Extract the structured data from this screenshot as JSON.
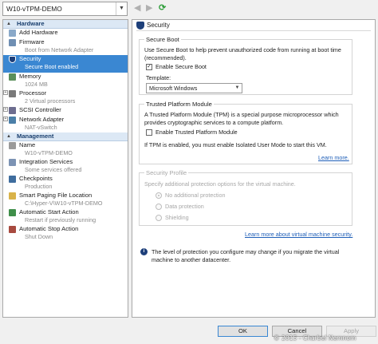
{
  "toolbar": {
    "vm_name": "W10-vTPM-DEMO",
    "back_glyph": "◀",
    "forward_glyph": "▶",
    "refresh_glyph": "⟳"
  },
  "sidebar": {
    "hardware": {
      "title": "Hardware",
      "items": [
        {
          "label": "Add Hardware",
          "sub": "",
          "icon": "add-hardware-icon"
        },
        {
          "label": "Firmware",
          "sub": "Boot from Network Adapter",
          "icon": "firmware-icon"
        },
        {
          "label": "Security",
          "sub": "Secure Boot enabled",
          "icon": "shield-icon",
          "selected": true
        },
        {
          "label": "Memory",
          "sub": "1024 MB",
          "icon": "memory-icon"
        },
        {
          "label": "Processor",
          "sub": "2 Virtual processors",
          "icon": "processor-icon"
        },
        {
          "label": "SCSI Controller",
          "sub": "",
          "icon": "scsi-controller-icon"
        },
        {
          "label": "Network Adapter",
          "sub": "NAT-vSwitch",
          "icon": "network-adapter-icon"
        }
      ]
    },
    "management": {
      "title": "Management",
      "items": [
        {
          "label": "Name",
          "sub": "W10-vTPM-DEMO",
          "icon": "name-icon"
        },
        {
          "label": "Integration Services",
          "sub": "Some services offered",
          "icon": "integration-services-icon"
        },
        {
          "label": "Checkpoints",
          "sub": "Production",
          "icon": "checkpoints-icon"
        },
        {
          "label": "Smart Paging File Location",
          "sub": "C:\\Hyper-V\\W10-vTPM-DEMO",
          "icon": "folder-icon"
        },
        {
          "label": "Automatic Start Action",
          "sub": "Restart if previously running",
          "icon": "start-action-icon"
        },
        {
          "label": "Automatic Stop Action",
          "sub": "Shut Down",
          "icon": "stop-action-icon"
        }
      ]
    }
  },
  "main": {
    "header": "Security",
    "secure_boot": {
      "title": "Secure Boot",
      "description": "Use Secure Boot to help prevent unauthorized code from running at boot time (recommended).",
      "enable_label": "Enable Secure Boot",
      "enable_checked": true,
      "template_label": "Template:",
      "template_value": "Microsoft Windows"
    },
    "tpm": {
      "title": "Trusted Platform Module",
      "description": "A Trusted Platform Module (TPM) is a special purpose microprocessor which provides cryptographic services to a compute platform.",
      "enable_label": "Enable Trusted Platform Module",
      "enable_checked": false,
      "note": "If TPM is enabled, you must enable Isolated User Mode to start this VM.",
      "learn_more": "Learn more."
    },
    "security_profile": {
      "title": "Security Profile",
      "description": "Specify additional protection options for the virtual machine.",
      "options": [
        "No additional protection",
        "Data protection",
        "Shielding"
      ],
      "selected_index": 0,
      "learn_more": "Learn more about virtual machine security."
    },
    "info": "The level of protection you configure may change if you migrate the virtual machine to another datacenter."
  },
  "buttons": {
    "ok": "OK",
    "cancel": "Cancel",
    "apply": "Apply"
  },
  "watermark": "© 2015 - Charbel Nemnom",
  "colors": {
    "selection": "#3a87d2",
    "link": "#1f5fb8",
    "section_header_bg": "#dce8f5",
    "shield": "#1d3f7a"
  }
}
